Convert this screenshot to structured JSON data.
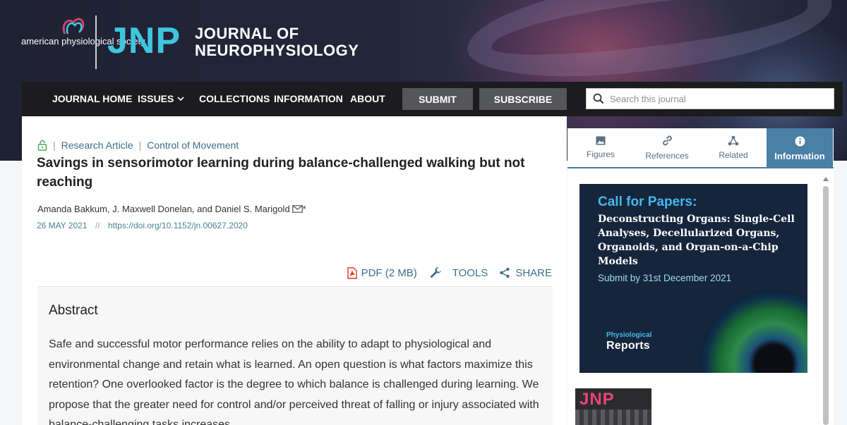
{
  "header": {
    "society_name": "american physiological society",
    "journal_abbr": "JNP",
    "journal_title_line1": "JOURNAL OF",
    "journal_title_line2": "NEUROPHYSIOLOGY"
  },
  "nav": {
    "items": [
      "JOURNAL HOME",
      "ISSUES",
      "COLLECTIONS",
      "INFORMATION",
      "ABOUT"
    ],
    "submit_label": "SUBMIT",
    "subscribe_label": "SUBSCRIBE",
    "search_placeholder": "Search this journal"
  },
  "article": {
    "access": "open-access-lock-icon",
    "type": "Research Article",
    "section": "Control of Movement",
    "title": "Savings in sensorimotor learning during balance-challenged walking but not reaching",
    "authors": "Amanda Bakkum, J. Maxwell Donelan, and Daniel S. Marigold",
    "corresponding_mark": "*",
    "date": "26 MAY 2021",
    "date_sep": "//",
    "doi": "https://doi.org/10.1152/jn.00627.2020",
    "pdf_label": "PDF (2 MB)",
    "tools_label": "TOOLS",
    "share_label": "SHARE",
    "abstract_heading": "Abstract",
    "abstract_text": "Safe and successful motor performance relies on the ability to adapt to physiological and environmental change and retain what is learned. An open question is what factors maximize this retention? One overlooked factor is the degree to which balance is challenged during learning. We propose that the greater need for control and/or perceived threat of falling or injury associated with balance-challenging tasks increases"
  },
  "sidebar": {
    "tabs": [
      {
        "label": "Figures",
        "icon": "image-icon"
      },
      {
        "label": "References",
        "icon": "link-icon"
      },
      {
        "label": "Related",
        "icon": "network-icon"
      },
      {
        "label": "Information",
        "icon": "info-icon",
        "active": true
      }
    ],
    "ad": {
      "heading": "Call for Papers:",
      "subject": "Deconstructing Organs: Single-Cell Analyses, Decellularized Organs, Organoids, and Organ-on-a-Chip Models",
      "due": "Submit by 31st December 2021",
      "brand_line1": "Physiological",
      "brand_line2": "Reports"
    },
    "cover_title": "JNP"
  },
  "colors": {
    "nav_bg": "#1c1c1e",
    "accent_blue": "#4a7fa6",
    "jnp_cyan": "#3ec6e0",
    "link": "#3d6f8a",
    "pdf_red": "#d93b2b"
  }
}
